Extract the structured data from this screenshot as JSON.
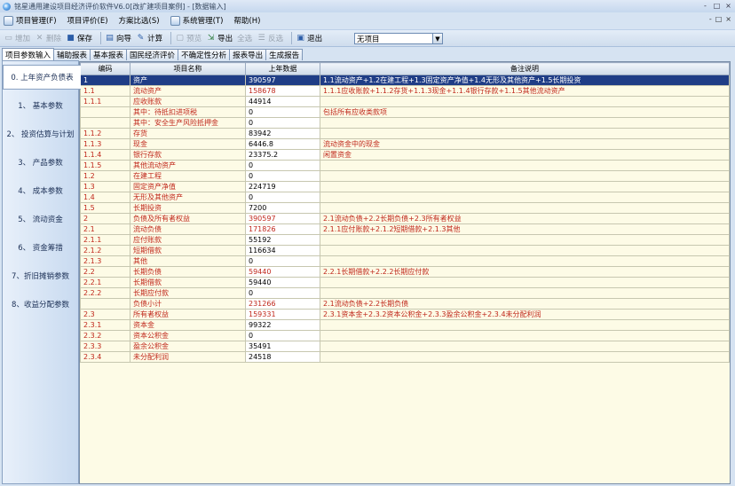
{
  "window": {
    "title": "铭星通用建设项目经济评价软件V6.0[改扩建项目案例] - [数据输入]",
    "controls": [
      "-",
      "□",
      "×"
    ]
  },
  "menu": [
    {
      "label": "项目管理(F)",
      "icon": "folder-icon"
    },
    {
      "label": "项目评价(E)",
      "icon": ""
    },
    {
      "label": "方案比选(S)",
      "icon": ""
    },
    {
      "label": "系统管理(T)",
      "icon": "gear-icon"
    },
    {
      "label": "帮助(H)",
      "icon": ""
    }
  ],
  "mdi_controls": [
    "-",
    "□",
    "×"
  ],
  "toolbar": {
    "add": "增加",
    "delete": "删除",
    "save": "保存",
    "wizard": "向导",
    "calc": "计算",
    "preview": "预览",
    "export": "导出",
    "select_all": "全选",
    "invert": "反选",
    "exit": "退出"
  },
  "project_select": {
    "value": "无项目"
  },
  "tabs": [
    "项目参数输入",
    "辅助报表",
    "基本报表",
    "国民经济评价",
    "不确定性分析",
    "报表导出",
    "生成报告"
  ],
  "nav": [
    "0. 上年资产负债表",
    "1、 基本参数",
    "2、 投资估算与计划",
    "3、 产品参数",
    "4、 成本参数",
    "5、 流动资金",
    "6、 资金筹措",
    "7、折旧摊销参数",
    "8、收益分配参数"
  ],
  "table": {
    "headers": [
      "编码",
      "项目名称",
      "上年数据",
      "备注说明"
    ],
    "rows": [
      {
        "code": "1",
        "name": "资产",
        "value": "390597",
        "note": "1.1流动资产+1.2在建工程+1.3固定资产净值+1.4无形及其他资产+1.5长期投资",
        "sel": true
      },
      {
        "code": "1.1",
        "name": "流动资产",
        "value": "158678",
        "note": "1.1.1应收账款+1.1.2存货+1.1.3现金+1.1.4银行存款+1.1.5其他流动资产",
        "red": true
      },
      {
        "code": "1.1.1",
        "name": "应收账款",
        "value": "44914",
        "note": ""
      },
      {
        "code": "",
        "name": "其中：待抵扣进项税",
        "value": "0",
        "note": "包括所有应收类款项"
      },
      {
        "code": "",
        "name": "其中：安全生产风险抵押金",
        "value": "0",
        "note": ""
      },
      {
        "code": "1.1.2",
        "name": "存货",
        "value": "83942",
        "note": ""
      },
      {
        "code": "1.1.3",
        "name": "现金",
        "value": "6446.8",
        "note": "流动资金中的现金"
      },
      {
        "code": "1.1.4",
        "name": "银行存款",
        "value": "23375.2",
        "note": "闲置资金"
      },
      {
        "code": "1.1.5",
        "name": "其他流动资产",
        "value": "0",
        "note": ""
      },
      {
        "code": "1.2",
        "name": "在建工程",
        "value": "0",
        "note": ""
      },
      {
        "code": "1.3",
        "name": "固定资产净值",
        "value": "224719",
        "note": ""
      },
      {
        "code": "1.4",
        "name": "无形及其他资产",
        "value": "0",
        "note": ""
      },
      {
        "code": "1.5",
        "name": "长期投资",
        "value": "7200",
        "note": ""
      },
      {
        "code": "2",
        "name": "负债及所有者权益",
        "value": "390597",
        "note": "2.1流动负债+2.2长期负债+2.3所有者权益",
        "red": true
      },
      {
        "code": "2.1",
        "name": "流动负债",
        "value": "171826",
        "note": "2.1.1应付账款+2.1.2短期借款+2.1.3其他",
        "red": true
      },
      {
        "code": "2.1.1",
        "name": "应付账款",
        "value": "55192",
        "note": ""
      },
      {
        "code": "2.1.2",
        "name": "短期借款",
        "value": "116634",
        "note": ""
      },
      {
        "code": "2.1.3",
        "name": "其他",
        "value": "0",
        "note": ""
      },
      {
        "code": "2.2",
        "name": "长期负债",
        "value": "59440",
        "note": "2.2.1长期借款+2.2.2长期应付款",
        "red": true
      },
      {
        "code": "2.2.1",
        "name": "长期借款",
        "value": "59440",
        "note": ""
      },
      {
        "code": "2.2.2",
        "name": "长期应付款",
        "value": "0",
        "note": ""
      },
      {
        "code": "",
        "name": "负债小计",
        "value": "231266",
        "note": "2.1流动负债+2.2长期负债",
        "red": true
      },
      {
        "code": "2.3",
        "name": "所有者权益",
        "value": "159331",
        "note": "2.3.1资本金+2.3.2资本公积金+2.3.3盈余公积金+2.3.4未分配利润",
        "red": true
      },
      {
        "code": "2.3.1",
        "name": "资本金",
        "value": "99322",
        "note": ""
      },
      {
        "code": "2.3.2",
        "name": "资本公积金",
        "value": "0",
        "note": ""
      },
      {
        "code": "2.3.3",
        "name": "盈余公积金",
        "value": "35491",
        "note": ""
      },
      {
        "code": "2.3.4",
        "name": "未分配利润",
        "value": "24518",
        "note": ""
      }
    ]
  }
}
